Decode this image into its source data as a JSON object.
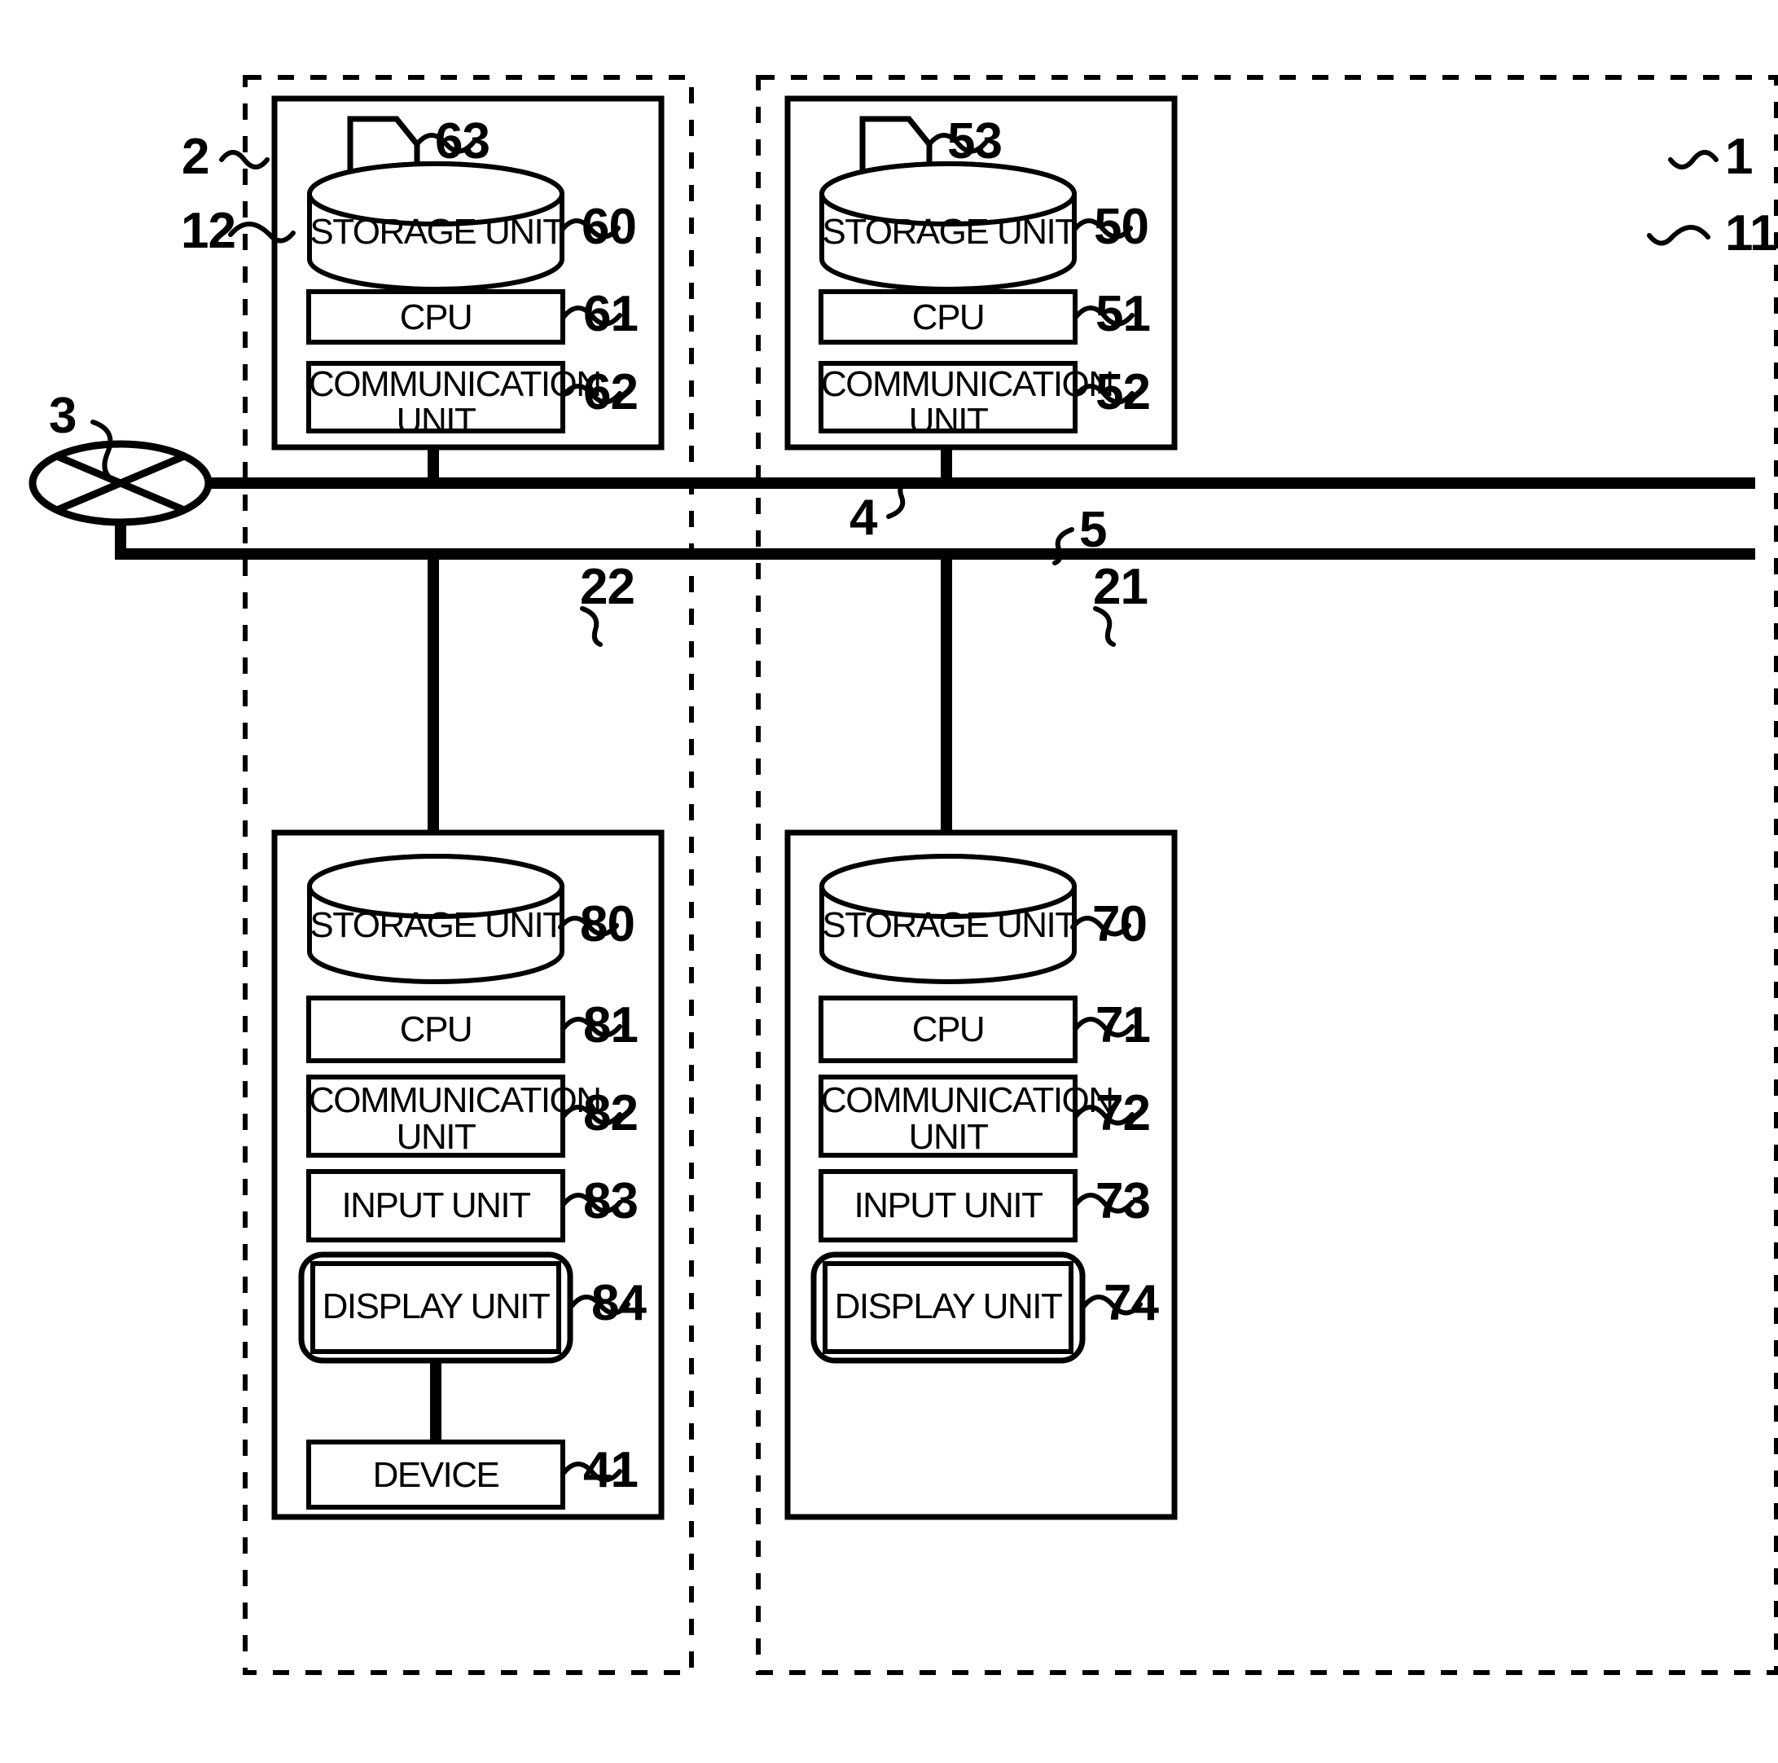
{
  "figure": {
    "type": "patent-block-diagram",
    "description": "Network system block diagram with two dashed domains each containing a server apparatus and a terminal apparatus connected by two buses through a network switch"
  },
  "reference_numerals": {
    "domain_left": "2",
    "domain_left_server": "12",
    "domain_right": "1",
    "domain_right_server": "11",
    "network_switch": "3",
    "bus_upper": "4",
    "bus_lower": "5",
    "terminal_left": "22",
    "terminal_right": "21",
    "left_server_storage": "60",
    "left_server_cpu": "61",
    "left_server_comm": "62",
    "left_server_file": "63",
    "right_server_storage": "50",
    "right_server_cpu": "51",
    "right_server_comm": "52",
    "right_server_file": "53",
    "left_terminal_storage": "80",
    "left_terminal_cpu": "81",
    "left_terminal_comm": "82",
    "left_terminal_input": "83",
    "left_terminal_display": "84",
    "left_terminal_device": "41",
    "right_terminal_storage": "70",
    "right_terminal_cpu": "71",
    "right_terminal_comm": "72",
    "right_terminal_input": "73",
    "right_terminal_display": "74"
  },
  "blocks": {
    "storage_unit": "STORAGE UNIT",
    "cpu": "CPU",
    "communication_unit_line1": "COMMUNICATION",
    "communication_unit_line2": "UNIT",
    "input_unit": "INPUT UNIT",
    "display_unit": "DISPLAY UNIT",
    "device": "DEVICE"
  },
  "colors": {
    "stroke": "#000000",
    "background": "#ffffff"
  }
}
